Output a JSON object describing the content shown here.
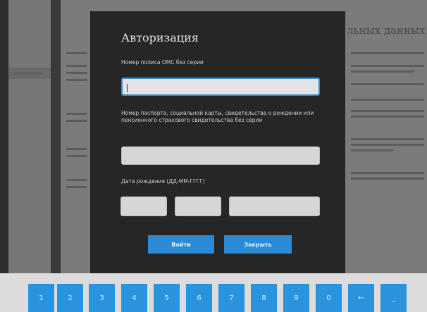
{
  "background": {
    "heading": "льных данных"
  },
  "modal": {
    "title": "Авторизация",
    "oms_label": "Номер полиса ОМС без серии",
    "oms_value": "",
    "passport_label": "Номер паспорта, социальной карты, свидетельства о рождении или пенсионного страхового свидетельства без серии",
    "passport_value": "",
    "birthdate_label": "Дата рождения (ДД-ММ-ГГГГ)",
    "day_value": "",
    "month_value": "",
    "year_value": "",
    "login_label": "Войти",
    "close_label": "Закрыть"
  },
  "keyboard": {
    "keys": [
      "1",
      "2",
      "3",
      "4",
      "5",
      "6",
      "7",
      "8",
      "9",
      "0",
      "←",
      "_"
    ]
  },
  "colors": {
    "accent": "#2a8bd8",
    "modal_bg": "#262626",
    "keyboard_bg": "#dcdcdc"
  }
}
